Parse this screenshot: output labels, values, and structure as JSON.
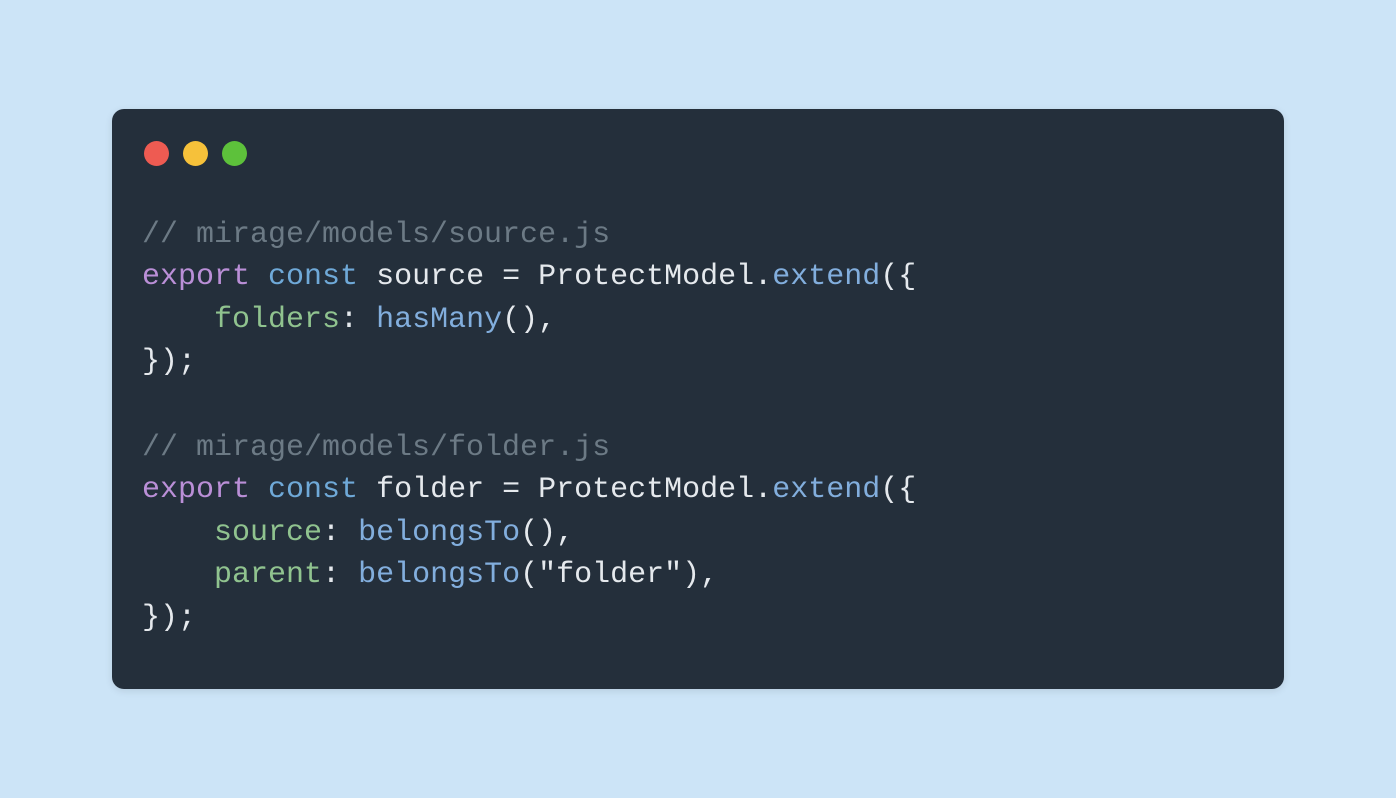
{
  "colors": {
    "background": "#cce4f7",
    "editor_bg": "#242f3b",
    "traffic_red": "#ee5b52",
    "traffic_yellow": "#f6c13a",
    "traffic_green": "#5dc13b",
    "comment": "#6c7a85",
    "keyword": "#ba8fd7",
    "const_kw": "#6fa9d8",
    "method": "#82aedd",
    "prop": "#90c38f",
    "text": "#e5e9ed"
  },
  "code": {
    "l1_comment": "// mirage/models/source.js",
    "l2_export": "export",
    "l2_const": "const",
    "l2_ident": "source",
    "l2_eq": " = ",
    "l2_type": "ProtectModel",
    "l2_dot": ".",
    "l2_method": "extend",
    "l2_open": "({",
    "l3_indent": "    ",
    "l3_prop": "folders",
    "l3_colon": ": ",
    "l3_func": "hasMany",
    "l3_tail": "(),",
    "l4_close": "});",
    "l5_blank": "",
    "l6_comment": "// mirage/models/folder.js",
    "l7_export": "export",
    "l7_const": "const",
    "l7_ident": "folder",
    "l7_eq": " = ",
    "l7_type": "ProtectModel",
    "l7_dot": ".",
    "l7_method": "extend",
    "l7_open": "({",
    "l8_indent": "    ",
    "l8_prop": "source",
    "l8_colon": ": ",
    "l8_func": "belongsTo",
    "l8_tail": "(),",
    "l9_indent": "    ",
    "l9_prop": "parent",
    "l9_colon": ": ",
    "l9_func": "belongsTo",
    "l9_open": "(",
    "l9_str": "\"folder\"",
    "l9_close": "),",
    "l10_close": "});"
  }
}
